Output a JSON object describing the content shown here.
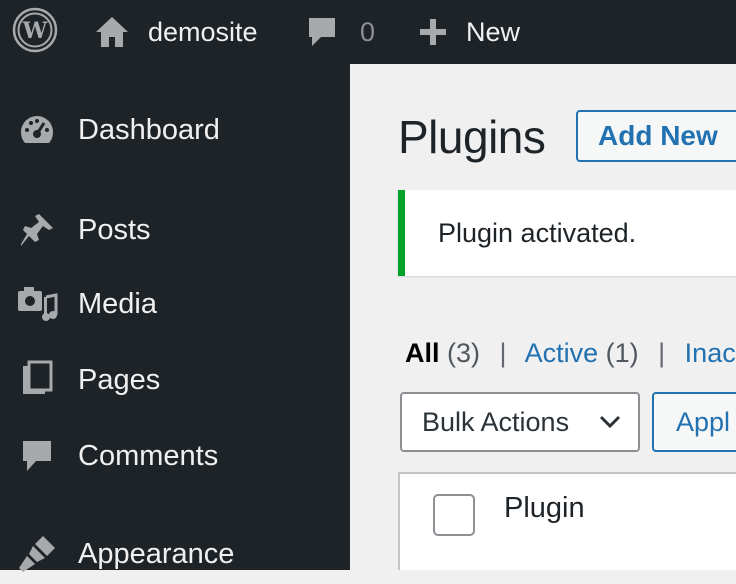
{
  "admin_bar": {
    "logo_icon": "wordpress-logo-icon",
    "site_icon": "home-icon",
    "site_name": "demosite",
    "comments_icon": "comment-bubble-icon",
    "comments_count": "0",
    "new_icon": "plus-icon",
    "new_label": "New"
  },
  "sidebar": {
    "items": [
      {
        "label": "Dashboard",
        "icon": "dashboard-gauge-icon"
      },
      {
        "label": "Posts",
        "icon": "pushpin-icon"
      },
      {
        "label": "Media",
        "icon": "media-camera-music-icon"
      },
      {
        "label": "Pages",
        "icon": "pages-icon"
      },
      {
        "label": "Comments",
        "icon": "comment-bubble-icon"
      },
      {
        "label": "Appearance",
        "icon": "paintbrush-icon"
      }
    ]
  },
  "main": {
    "title": "Plugins",
    "add_new_label": "Add New",
    "notice": "Plugin activated.",
    "filters": {
      "all_label": "All",
      "all_count": "(3)",
      "separator": "|",
      "active_label": "Active",
      "active_count": "(1)",
      "inactive_label": "Inac"
    },
    "bulk_actions_label": "Bulk Actions",
    "apply_label": "Appl",
    "table": {
      "column_plugin": "Plugin"
    }
  },
  "colors": {
    "admin_bar_bg": "#1d2327",
    "accent_blue": "#2271b1",
    "notice_success": "#00a32a",
    "content_bg": "#f0f0f1"
  }
}
